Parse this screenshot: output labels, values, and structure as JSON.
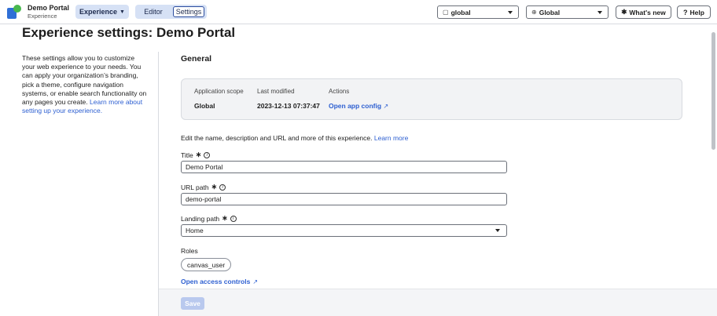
{
  "topbar": {
    "app_title": "Demo Portal",
    "app_subtitle": "Experience",
    "experience_menu_label": "Experience",
    "tab_editor_label": "Editor",
    "tab_settings_label": "Settings",
    "scope_dropdown_value": "global",
    "language_dropdown_value": "Global",
    "whats_new_label": "What's new",
    "help_label": "Help",
    "brand_colors": {
      "blue": "#2f6fd6",
      "green": "#48b84d"
    }
  },
  "page": {
    "title": "Experience settings: Demo Portal",
    "description": "These settings allow you to customize your web experience to your needs. You can apply your organization’s branding, pick a theme, configure navigation systems, or enable search functionality on any pages you create.",
    "description_link": "Learn more about setting up your experience."
  },
  "general": {
    "section_title": "General",
    "info_headers": {
      "scope": "Application scope",
      "modified": "Last modified",
      "actions": "Actions"
    },
    "info_values": {
      "scope": "Global",
      "modified": "2023-12-13 07:37:47",
      "action_link": "Open app config"
    },
    "edit_text": "Edit the name, description and URL and more of this experience.",
    "edit_link": "Learn more",
    "fields": {
      "title_label": "Title",
      "title_value": "Demo Portal",
      "url_label": "URL path",
      "url_value": "demo-portal",
      "landing_label": "Landing path",
      "landing_value": "Home",
      "roles_label": "Roles",
      "roles": [
        "canvas_user"
      ]
    },
    "access_controls_link": "Open access controls",
    "save_label": "Save"
  },
  "icons": {
    "scope": "document-icon",
    "language": "globe-icon",
    "whats_new": "sparkle-icon",
    "help": "help-circle-icon",
    "external": "external-link-icon",
    "info": "info-icon"
  }
}
